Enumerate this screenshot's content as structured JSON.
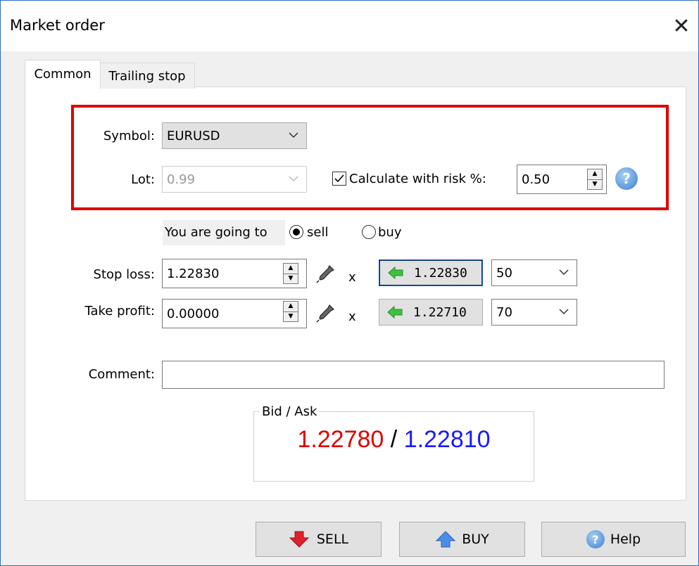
{
  "window": {
    "title": "Market order",
    "close_label": "✕"
  },
  "tabs": [
    {
      "label": "Common",
      "active": true
    },
    {
      "label": "Trailing stop",
      "active": false
    }
  ],
  "symbol": {
    "label": "Symbol:",
    "value": "EURUSD"
  },
  "lot": {
    "label": "Lot:",
    "value": "0.99",
    "disabled": true
  },
  "risk": {
    "checkbox_label": "Calculate with risk %:",
    "checked": true,
    "value": "0.50",
    "help_icon": "help-icon"
  },
  "direction": {
    "prompt": "You are going to",
    "sell_label": "sell",
    "buy_label": "buy",
    "selected": "sell"
  },
  "stop_loss": {
    "label": "Stop loss:",
    "value": "1.22830",
    "price_button": "1.22830",
    "points": "50",
    "clear_label": "x"
  },
  "take_profit": {
    "label": "Take profit:",
    "value": "0.00000",
    "price_button": "1.22710",
    "points": "70",
    "clear_label": "x"
  },
  "comment": {
    "label": "Comment:",
    "value": ""
  },
  "bid_ask": {
    "legend": "Bid / Ask",
    "bid": "1.22780",
    "separator": " / ",
    "ask": "1.22810",
    "bid_color": "#e00000",
    "ask_color": "#1a1aff"
  },
  "buttons": {
    "sell": "SELL",
    "buy": "BUY",
    "help": "Help"
  },
  "colors": {
    "highlight_border": "#e00000",
    "sell_arrow": "#e0202a",
    "buy_arrow": "#4a8ee8",
    "price_arrow": "#3cc23c"
  }
}
